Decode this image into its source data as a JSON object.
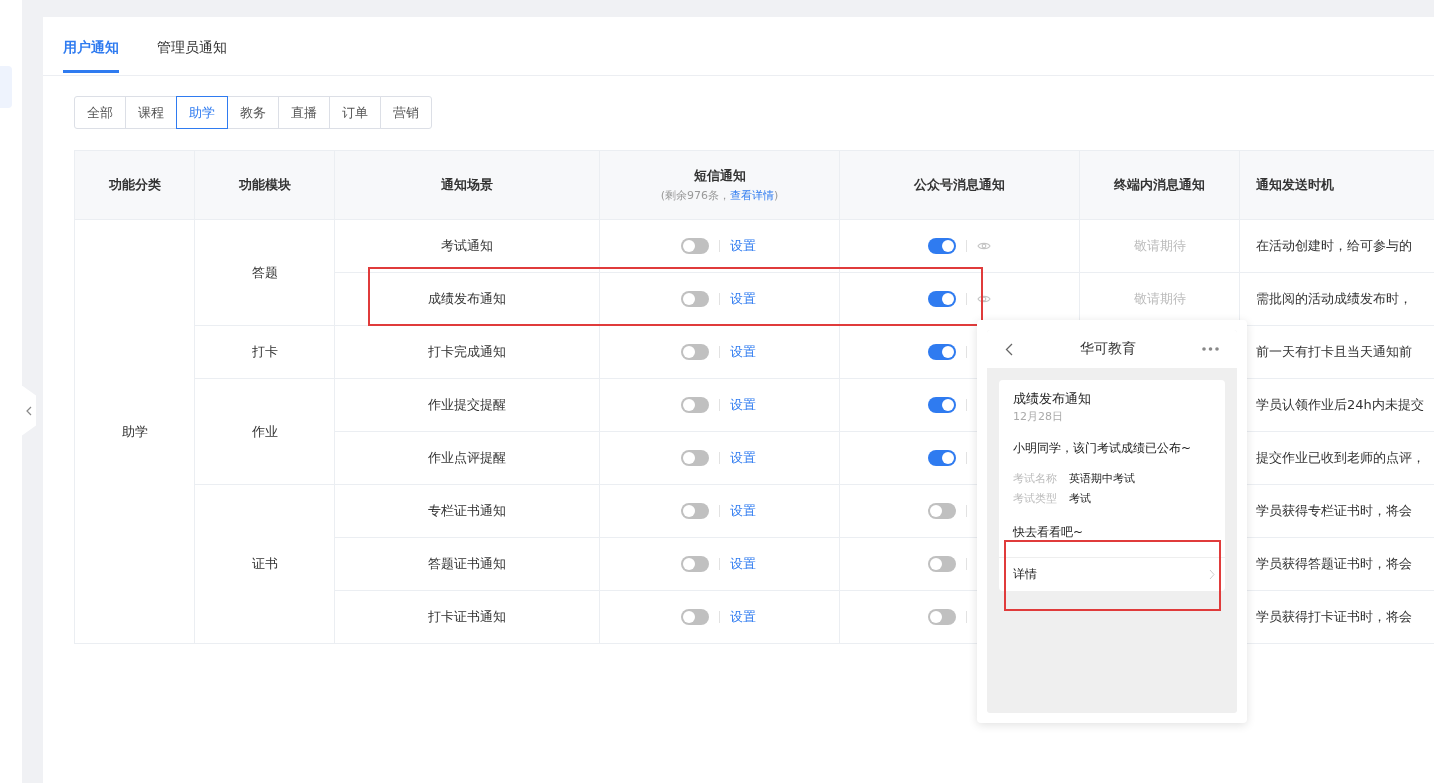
{
  "tabs": [
    {
      "label": "用户通知",
      "selected": true
    },
    {
      "label": "管理员通知",
      "selected": false
    }
  ],
  "filters": [
    {
      "label": "全部",
      "selected": false
    },
    {
      "label": "课程",
      "selected": false
    },
    {
      "label": "助学",
      "selected": true
    },
    {
      "label": "教务",
      "selected": false
    },
    {
      "label": "直播",
      "selected": false
    },
    {
      "label": "订单",
      "selected": false
    },
    {
      "label": "营销",
      "selected": false
    }
  ],
  "table": {
    "columns": [
      {
        "label": "功能分类"
      },
      {
        "label": "功能模块"
      },
      {
        "label": "通知场景"
      },
      {
        "label": "短信通知",
        "note_before": "(剩余976条，",
        "note_link": "查看详情",
        "note_after": ")"
      },
      {
        "label": "公众号消息通知"
      },
      {
        "label": "终端内消息通知"
      },
      {
        "label": "通知发送时机"
      }
    ],
    "categories": [
      {
        "name": "助学",
        "modules": [
          {
            "name": "答题",
            "scenes": [
              {
                "name": "考试通知",
                "sms_on": false,
                "sms_link": "设置",
                "wechat_on": true,
                "wechat_preview": true,
                "terminal": "敬请期待",
                "timing": "在活动创建时，给可参与的"
              },
              {
                "name": "成绩发布通知",
                "sms_on": false,
                "sms_link": "设置",
                "wechat_on": true,
                "wechat_preview": true,
                "terminal": "敬请期待",
                "timing": "需批阅的活动成绩发布时，"
              }
            ]
          },
          {
            "name": "打卡",
            "scenes": [
              {
                "name": "打卡完成通知",
                "sms_on": false,
                "sms_link": "设置",
                "wechat_on": true,
                "timing": "前一天有打卡且当天通知前"
              }
            ]
          },
          {
            "name": "作业",
            "scenes": [
              {
                "name": "作业提交提醒",
                "sms_on": false,
                "sms_link": "设置",
                "wechat_on": true,
                "timing": "学员认领作业后24h内未提交"
              },
              {
                "name": "作业点评提醒",
                "sms_on": false,
                "sms_link": "设置",
                "wechat_on": true,
                "timing": "提交作业已收到老师的点评，"
              }
            ]
          },
          {
            "name": "证书",
            "scenes": [
              {
                "name": "专栏证书通知",
                "sms_on": false,
                "sms_link": "设置",
                "wechat_on": false,
                "timing": "学员获得专栏证书时，将会"
              },
              {
                "name": "答题证书通知",
                "sms_on": false,
                "sms_link": "设置",
                "wechat_on": false,
                "timing": "学员获得答题证书时，将会"
              },
              {
                "name": "打卡证书通知",
                "sms_on": false,
                "sms_link": "设置",
                "wechat_on": false,
                "timing": "学员获得打卡证书时，将会"
              }
            ]
          }
        ]
      }
    ]
  },
  "preview": {
    "title": "华可教育",
    "card_title": "成绩发布通知",
    "date": "12月28日",
    "greeting": "小明同学，该门考试成绩已公布~",
    "fields": [
      {
        "label": "考试名称",
        "value": "英语期中考试"
      },
      {
        "label": "考试类型",
        "value": "考试"
      }
    ],
    "closing": "快去看看吧~",
    "link": "详情"
  }
}
